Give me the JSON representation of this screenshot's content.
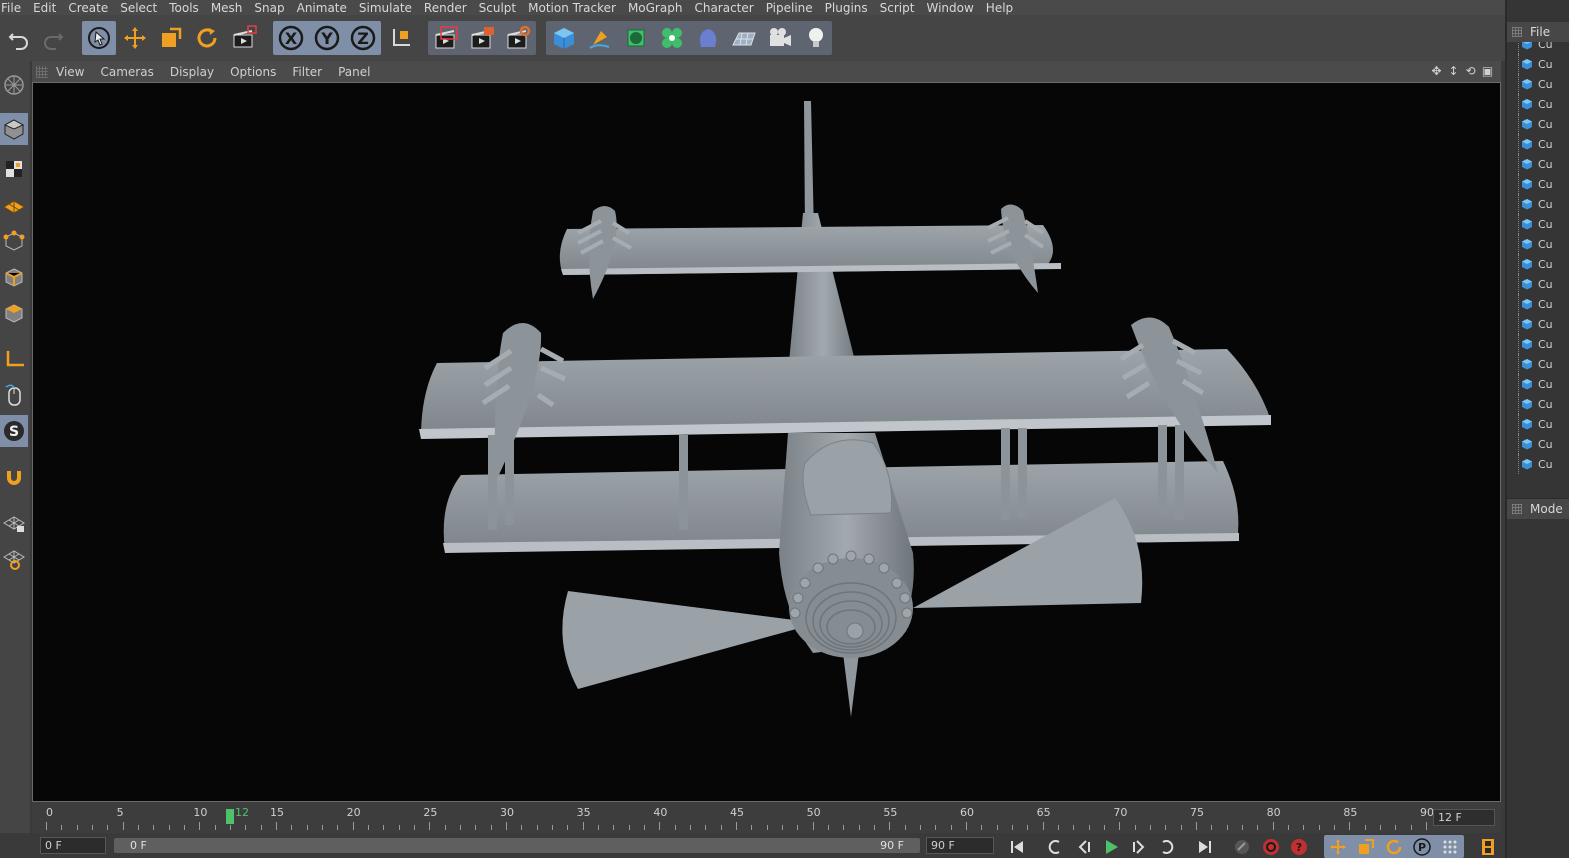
{
  "menu": [
    "File",
    "Edit",
    "Create",
    "Select",
    "Tools",
    "Mesh",
    "Snap",
    "Animate",
    "Simulate",
    "Render",
    "Sculpt",
    "Motion Tracker",
    "MoGraph",
    "Character",
    "Pipeline",
    "Plugins",
    "Script",
    "Window",
    "Help"
  ],
  "toolbar": {
    "undo_icon": "undo-icon",
    "redo_icon": "redo-icon",
    "axis_x": "X",
    "axis_y": "Y",
    "axis_z": "Z"
  },
  "viewport": {
    "menu": [
      "View",
      "Cameras",
      "Display",
      "Options",
      "Filter",
      "Panel"
    ],
    "nav_icons": [
      "move-view-icon",
      "zoom-view-icon",
      "rotate-view-icon",
      "maximize-view-icon"
    ]
  },
  "timeline": {
    "ticks": [
      "0",
      "5",
      "10",
      "12",
      "15",
      "20",
      "25",
      "30",
      "35",
      "40",
      "45",
      "50",
      "55",
      "60",
      "65",
      "70",
      "75",
      "80",
      "85",
      "90"
    ],
    "current_frame": 12,
    "max_frame": 90,
    "current_frame_field": "12 F"
  },
  "bottombar": {
    "start_field": "0 F",
    "slider_start": "0 F",
    "slider_end": "90 F",
    "end_field": "90 F"
  },
  "object_manager": {
    "header": "File",
    "items": [
      "Cu",
      "Cu",
      "Cu",
      "Cu",
      "Cu",
      "Cu",
      "Cu",
      "Cu",
      "Cu",
      "Cu",
      "Cu",
      "Cu",
      "Cu",
      "Cu",
      "Cu",
      "Cu",
      "Cu",
      "Cu",
      "Cu",
      "Cu",
      "Cu",
      "Cu"
    ]
  },
  "attributes": {
    "header": "Mode"
  },
  "colors": {
    "accent_orange": "#f0a020",
    "accent_blue": "#4aa8e0",
    "playhead_green": "#4ec26b",
    "model_gray": "#8f969c"
  }
}
